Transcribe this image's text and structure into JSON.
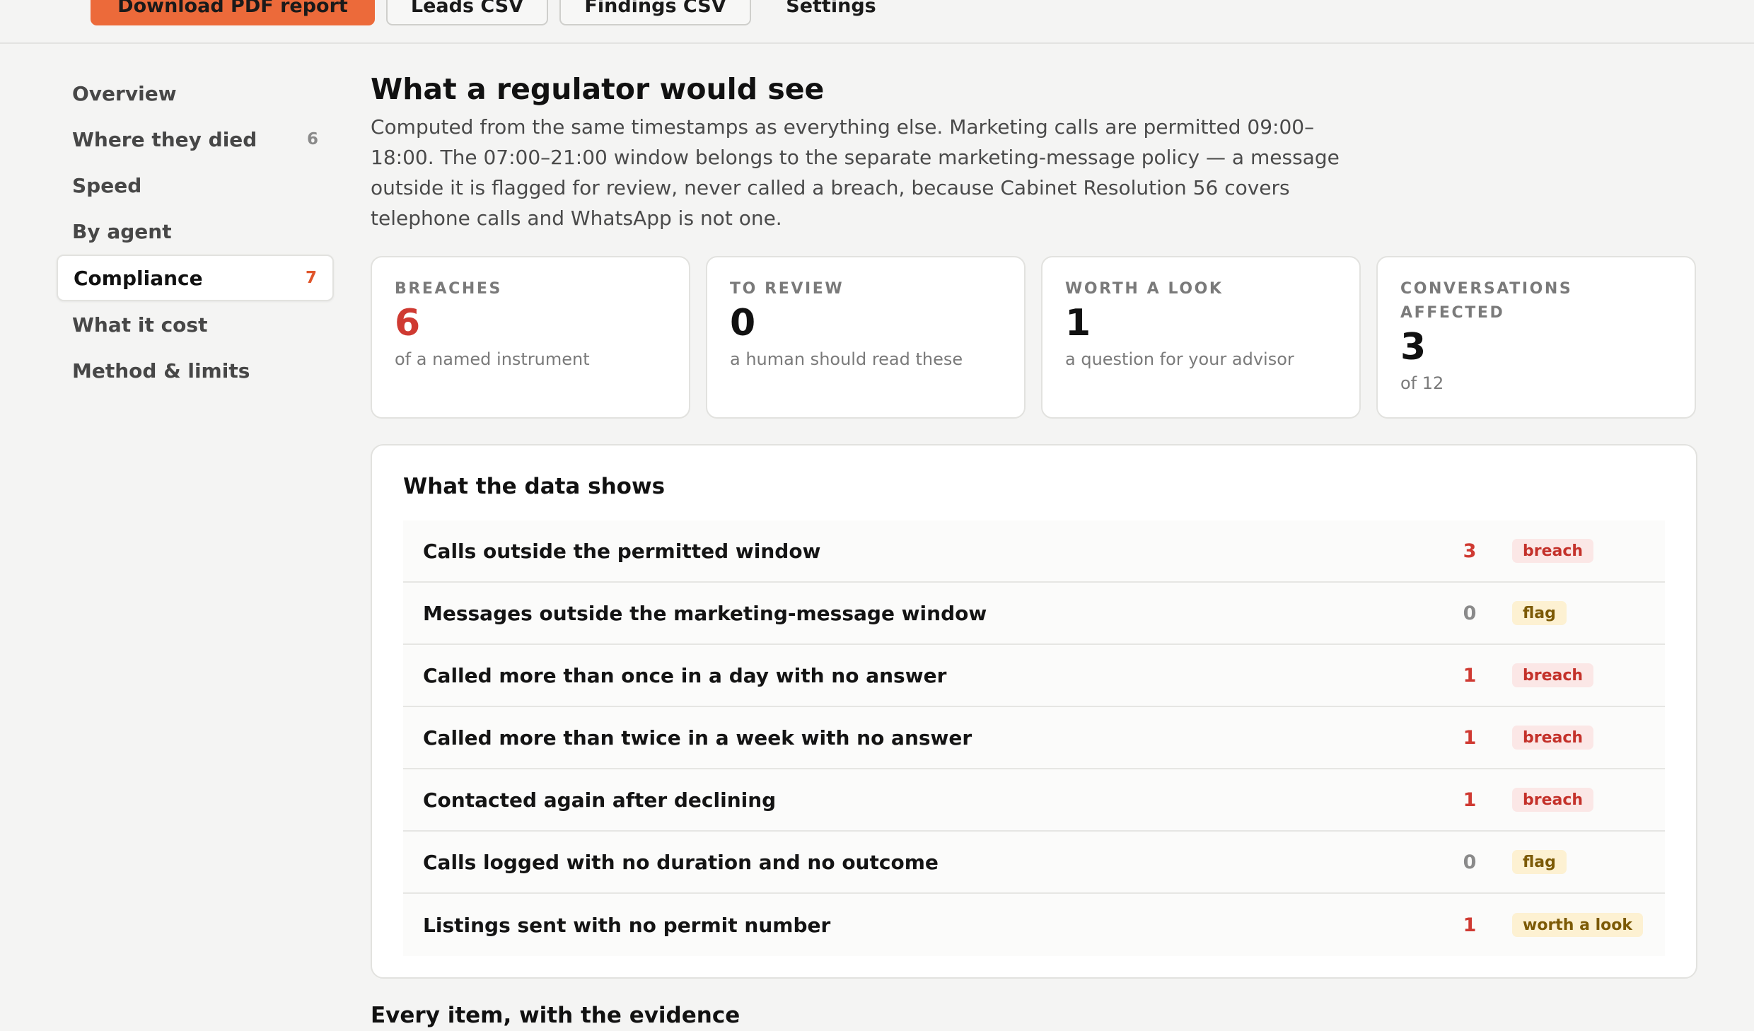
{
  "toolbar": {
    "download_pdf": "Download PDF report",
    "leads_csv": "Leads CSV",
    "findings_csv": "Findings CSV",
    "settings": "Settings"
  },
  "sidebar": {
    "items": [
      {
        "label": "Overview",
        "count": ""
      },
      {
        "label": "Where they died",
        "count": "6"
      },
      {
        "label": "Speed",
        "count": ""
      },
      {
        "label": "By agent",
        "count": ""
      },
      {
        "label": "Compliance",
        "count": "7",
        "active": true
      },
      {
        "label": "What it cost",
        "count": ""
      },
      {
        "label": "Method & limits",
        "count": ""
      }
    ]
  },
  "main": {
    "title": "What a regulator would see",
    "lede": "Computed from the same timestamps as everything else. Marketing calls are permitted 09:00–18:00. The 07:00–21:00 window belongs to the separate marketing-message policy — a message outside it is flagged for review, never called a breach, because Cabinet Resolution 56 covers telephone calls and WhatsApp is not one.",
    "stats": [
      {
        "label": "BREACHES",
        "value": "6",
        "sub": "of a named instrument",
        "color": "#cf3a32"
      },
      {
        "label": "TO REVIEW",
        "value": "0",
        "sub": "a human should read these"
      },
      {
        "label": "WORTH A LOOK",
        "value": "1",
        "sub": "a question for your advisor"
      },
      {
        "label": "CONVERSATIONS AFFECTED",
        "value": "3",
        "sub": "of 12"
      }
    ],
    "panel": {
      "title": "What the data shows",
      "rows": [
        {
          "label": "Calls outside the permitted window",
          "count": "3",
          "tag": "breach"
        },
        {
          "label": "Messages outside the marketing-message window",
          "count": "0",
          "tag": "flag"
        },
        {
          "label": "Called more than once in a day with no answer",
          "count": "1",
          "tag": "breach"
        },
        {
          "label": "Called more than twice in a week with no answer",
          "count": "1",
          "tag": "breach"
        },
        {
          "label": "Contacted again after declining",
          "count": "1",
          "tag": "breach"
        },
        {
          "label": "Calls logged with no duration and no outcome",
          "count": "0",
          "tag": "flag"
        },
        {
          "label": "Listings sent with no permit number",
          "count": "1",
          "tag": "worth a look"
        }
      ]
    },
    "next_heading": "Every item, with the evidence"
  },
  "colors": {
    "accent": "#ec6a3a",
    "breach": "#cf3a32",
    "flag_bg": "#fdf1d2"
  }
}
